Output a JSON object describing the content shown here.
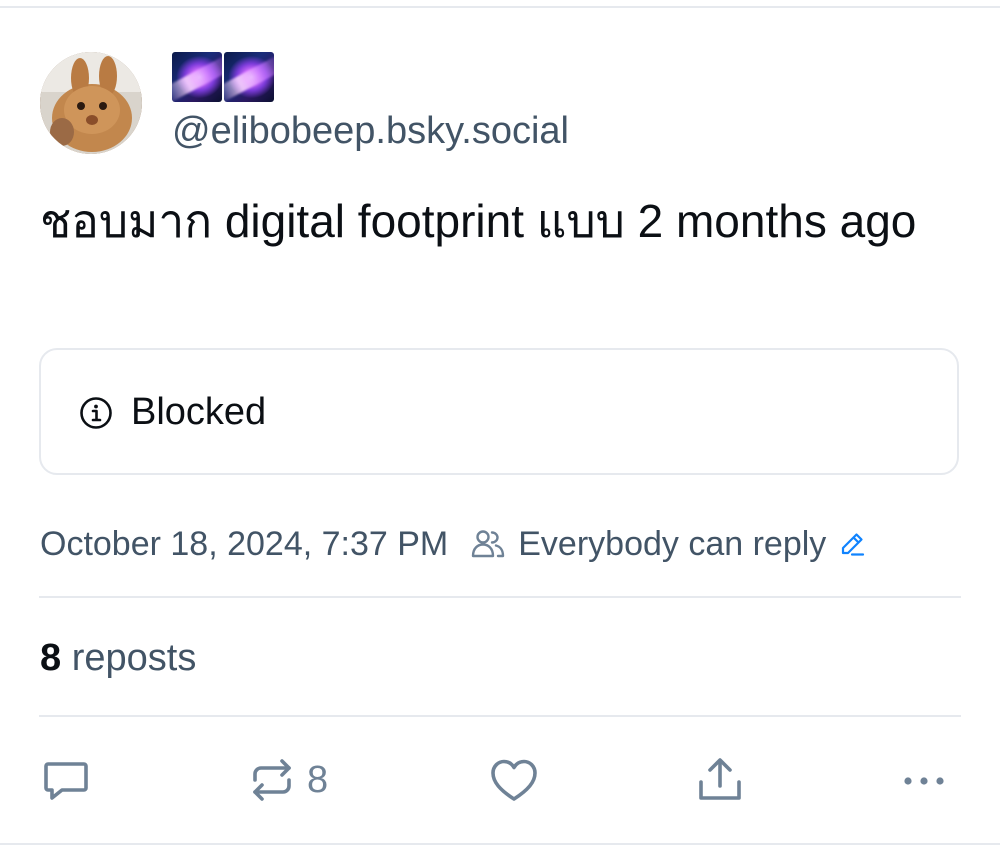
{
  "post": {
    "author": {
      "display_name_emoji": [
        "galaxy-emoji",
        "galaxy-emoji"
      ],
      "handle": "@elibobeep.bsky.social",
      "avatar": "bunny-avatar"
    },
    "text": "ชอบมาก digital footprint แบบ 2 months ago",
    "embed": {
      "icon": "info-icon",
      "label": "Blocked"
    },
    "timestamp": "October 18, 2024, 7:37 PM",
    "reply_setting": "Everybody can reply",
    "stats": {
      "reposts_count": "8",
      "reposts_label": "reposts"
    },
    "actions": {
      "reply_icon": "comment-icon",
      "repost_icon": "repost-icon",
      "repost_count": "8",
      "like_icon": "heart-icon",
      "share_icon": "share-icon",
      "more_icon": "more-icon"
    },
    "colors": {
      "text": "#0b0f14",
      "muted": "#425466",
      "icon": "#6f8296",
      "accent": "#1083fe",
      "border": "#e6e9ee"
    }
  }
}
